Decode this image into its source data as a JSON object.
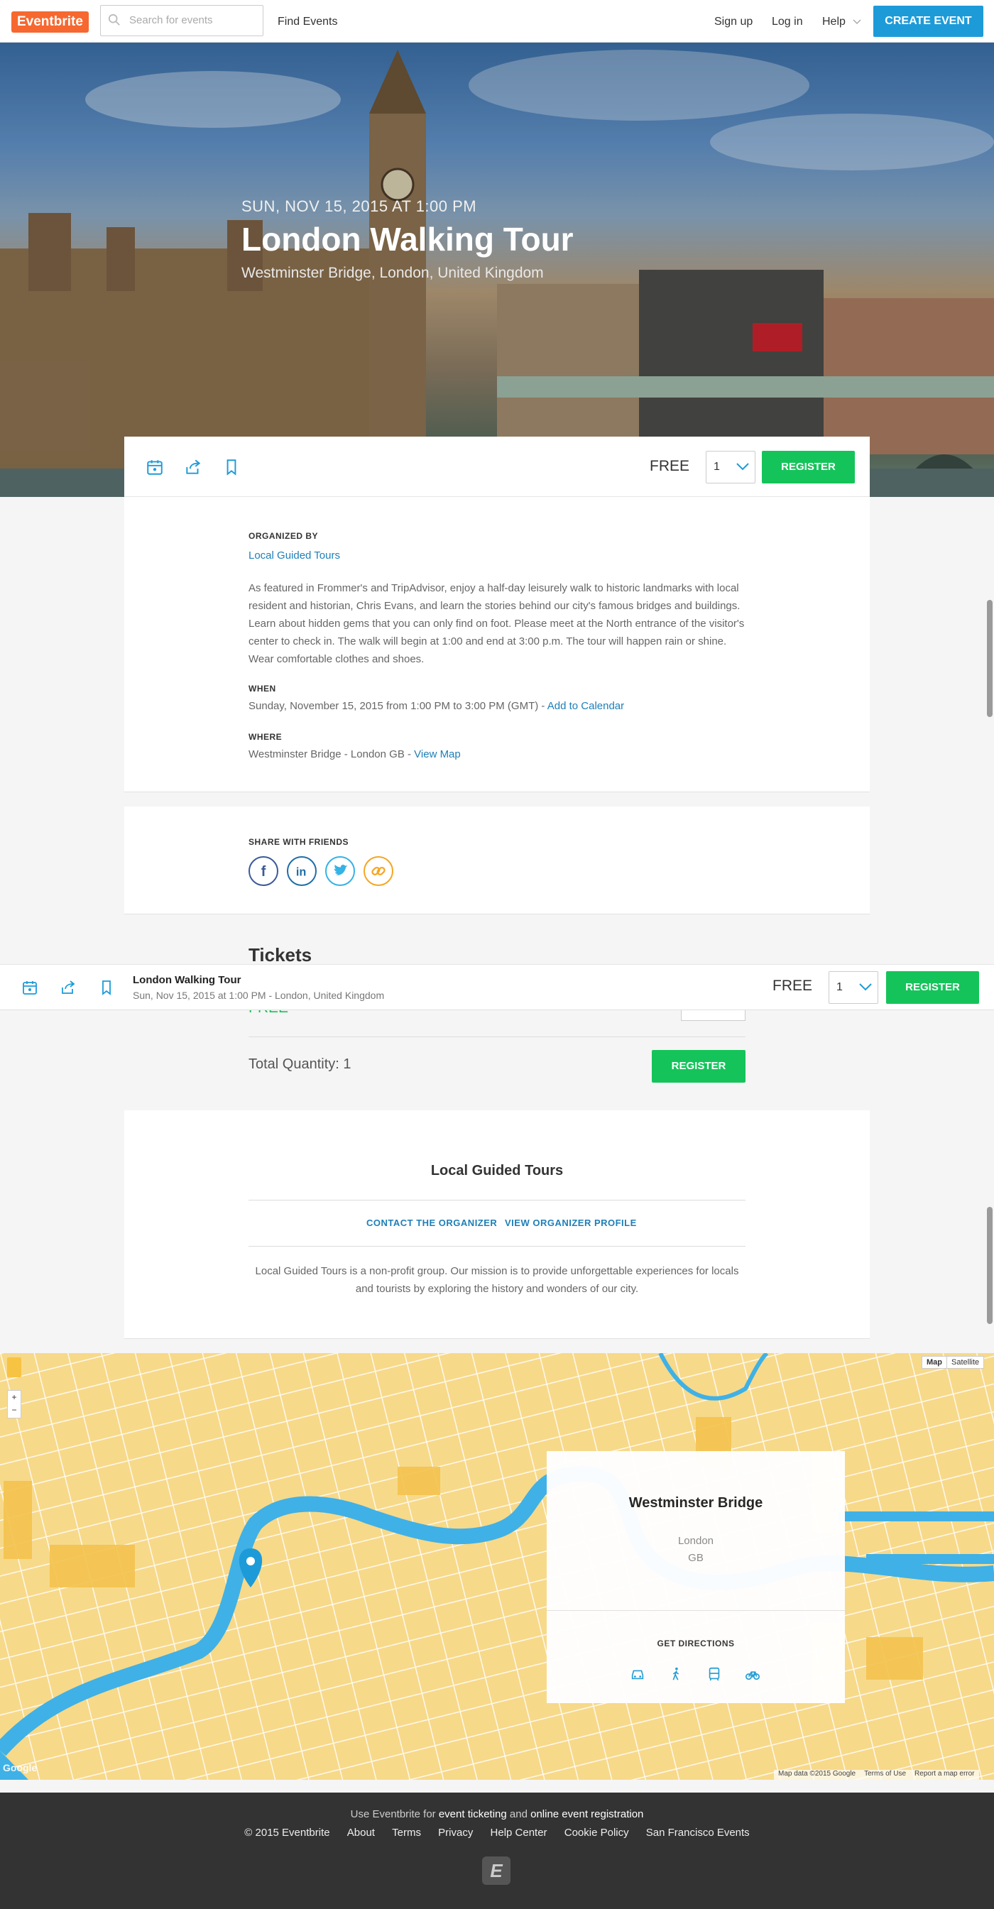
{
  "header": {
    "logo": "Eventbrite",
    "search_placeholder": "Search for events",
    "find_events": "Find Events",
    "sign_up": "Sign up",
    "log_in": "Log in",
    "help": "Help",
    "create_event": "CREATE EVENT"
  },
  "hero": {
    "date": "SUN, NOV 15, 2015 AT 1:00 PM",
    "title": "London Walking Tour",
    "location": "Westminster Bridge, London, United Kingdom"
  },
  "action_bar": {
    "price": "FREE",
    "quantity": "1",
    "register": "REGISTER"
  },
  "details": {
    "organized_by_label": "ORGANIZED BY",
    "organizer": "Local Guided Tours",
    "description": "As featured in Frommer's and TripAdvisor, enjoy a half-day leisurely walk to historic landmarks with local resident and historian, Chris Evans, and learn the stories behind our city's famous bridges and buildings. Learn about hidden gems that you can only find on foot. Please meet at the North entrance of the visitor's center to check in. The walk will begin at 1:00 and end at 3:00 p.m. The tour will happen rain or shine. Wear comfortable clothes and shoes.",
    "when_label": "WHEN",
    "when_text": "Sunday, November 15, 2015 from 1:00 PM to 3:00 PM (GMT) - ",
    "add_to_calendar": "Add to Calendar",
    "where_label": "WHERE",
    "where_text": "Westminster Bridge - London GB - ",
    "view_map": "View Map"
  },
  "share": {
    "label": "SHARE WITH FRIENDS"
  },
  "tickets": {
    "heading": "Tickets",
    "free_partial": "FREE",
    "total_quantity": "Total Quantity: 1",
    "register": "REGISTER"
  },
  "sticky_bar": {
    "title": "London Walking Tour",
    "subtitle": "Sun, Nov 15, 2015 at 1:00 PM - London, United Kingdom",
    "price": "FREE",
    "quantity": "1",
    "register": "REGISTER"
  },
  "organizer_card": {
    "name": "Local Guided Tours",
    "contact": "CONTACT THE ORGANIZER",
    "profile": "VIEW ORGANIZER PROFILE",
    "about": "Local Guided Tours is a non-profit group. Our mission is to provide unforgettable experiences for locals and tourists by exploring the history and wonders of our city."
  },
  "map": {
    "map_btn": "Map",
    "satellite_btn": "Satellite",
    "venue": "Westminster Bridge",
    "city": "London",
    "country": "GB",
    "get_directions": "GET DIRECTIONS",
    "attribution": "Map data ©2015 Google",
    "terms": "Terms of Use",
    "report": "Report a map error",
    "google": "Google",
    "zoom_in": "+",
    "zoom_out": "−"
  },
  "footer": {
    "use_prefix": "Use Eventbrite for ",
    "ticketing": "event ticketing",
    "and": " and ",
    "registration": "online event registration",
    "copyright": "© 2015 Eventbrite",
    "about": "About",
    "terms": "Terms",
    "privacy": "Privacy",
    "help_center": "Help Center",
    "cookie_policy": "Cookie Policy",
    "sf_events": "San Francisco Events",
    "badge": "E"
  },
  "colors": {
    "brand_orange": "#f6682f",
    "primary_blue": "#1d9bd8",
    "register_green": "#14c45a",
    "link_blue": "#1d7fb8",
    "map_water": "#3fb1e6",
    "map_land": "#f7d98a"
  }
}
